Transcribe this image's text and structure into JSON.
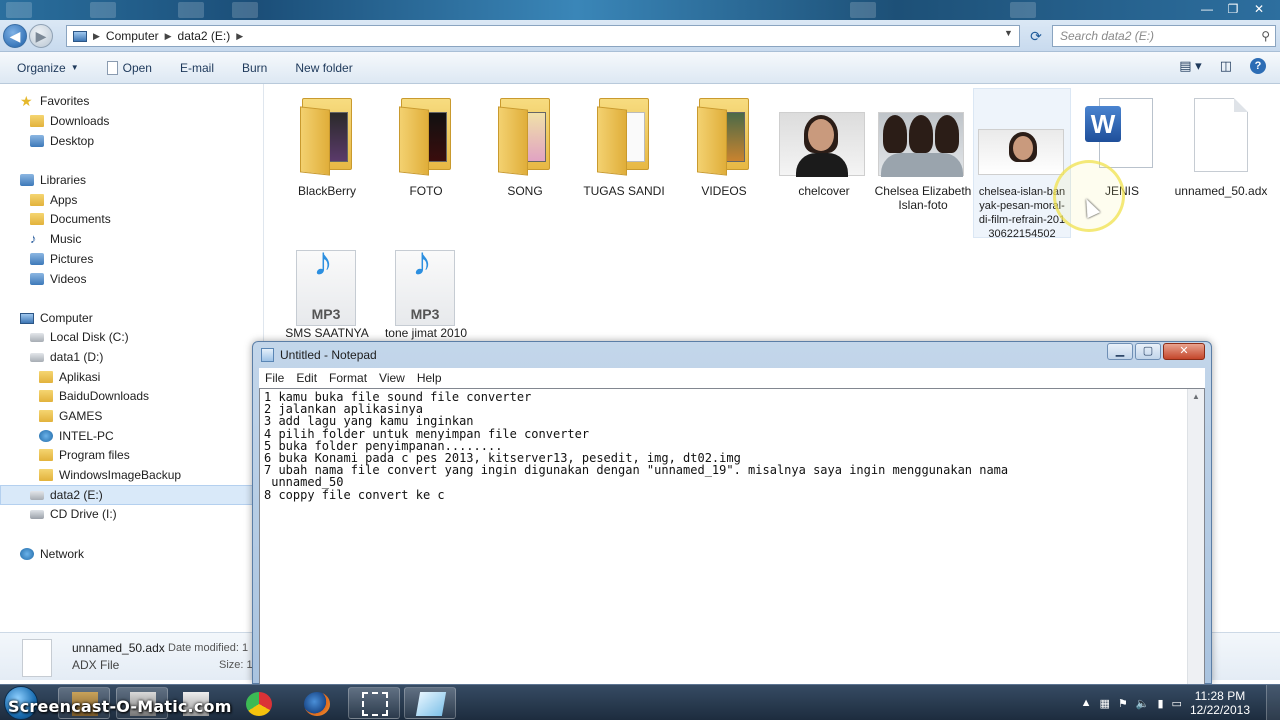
{
  "explorer": {
    "caption_buttons": [
      "—",
      "❐",
      "✕"
    ],
    "breadcrumb": [
      "Computer",
      "data2 (E:)"
    ],
    "search_placeholder": "Search data2 (E:)",
    "toolbar": {
      "organize": "Organize",
      "open": "Open",
      "email": "E-mail",
      "burn": "Burn",
      "new_folder": "New folder"
    },
    "sidebar": {
      "favorites": "Favorites",
      "downloads": "Downloads",
      "desktop": "Desktop",
      "libraries": "Libraries",
      "apps": "Apps",
      "documents": "Documents",
      "music": "Music",
      "pictures": "Pictures",
      "videos": "Videos",
      "computer": "Computer",
      "local_disk": "Local Disk (C:)",
      "data1": "data1 (D:)",
      "aplikasi": "Aplikasi",
      "baidu": "BaiduDownloads",
      "games": "GAMES",
      "intel": "INTEL-PC",
      "program_files": "Program files",
      "wib": "WindowsImageBackup",
      "data2": "data2 (E:)",
      "cd": "CD Drive (I:)",
      "network": "Network"
    },
    "files": [
      {
        "name": "BlackBerry",
        "type": "folder"
      },
      {
        "name": "FOTO",
        "type": "folder"
      },
      {
        "name": "SONG",
        "type": "folder"
      },
      {
        "name": "TUGAS SANDI",
        "type": "folder"
      },
      {
        "name": "VIDEOS",
        "type": "folder"
      },
      {
        "name": "chelcover",
        "type": "image"
      },
      {
        "name": "Chelsea Elizabeth Islan-foto",
        "type": "image"
      },
      {
        "name": "chelsea-islan-banyak-pesan-moral-di-film-refrain-20130622154502",
        "type": "image"
      },
      {
        "name": "JENIS",
        "type": "word"
      },
      {
        "name": "unnamed_50.adx",
        "type": "file"
      },
      {
        "name": "SMS SAATNYA",
        "type": "mp3"
      },
      {
        "name": "tone jimat 2010",
        "type": "mp3"
      }
    ],
    "mp3_label": "MP3",
    "details": {
      "filename": "unnamed_50.adx",
      "filetype": "ADX File",
      "modified_label": "Date modified: 1",
      "size_label": "Size: 1"
    }
  },
  "notepad": {
    "title": "Untitled - Notepad",
    "menu": [
      "File",
      "Edit",
      "Format",
      "View",
      "Help"
    ],
    "text": "1 kamu buka file sound file converter\n2 jalankan aplikasinya\n3 add lagu yang kamu inginkan\n4 pilih folder untuk menyimpan file converter\n5 buka folder penyimpanan........\n6 buka Konami pada c pes 2013, kitserver13, pesedit, img, dt02.img\n7 ubah nama file convert yang ingin digunakan dengan \"unnamed_19\". misalnya saya ingin menggunakan nama\n unnamed_50\n8 coppy file convert ke c"
  },
  "taskbar": {
    "watermark": "Screencast-O-Matic.com",
    "time": "11:28 PM",
    "date": "12/22/2013"
  }
}
